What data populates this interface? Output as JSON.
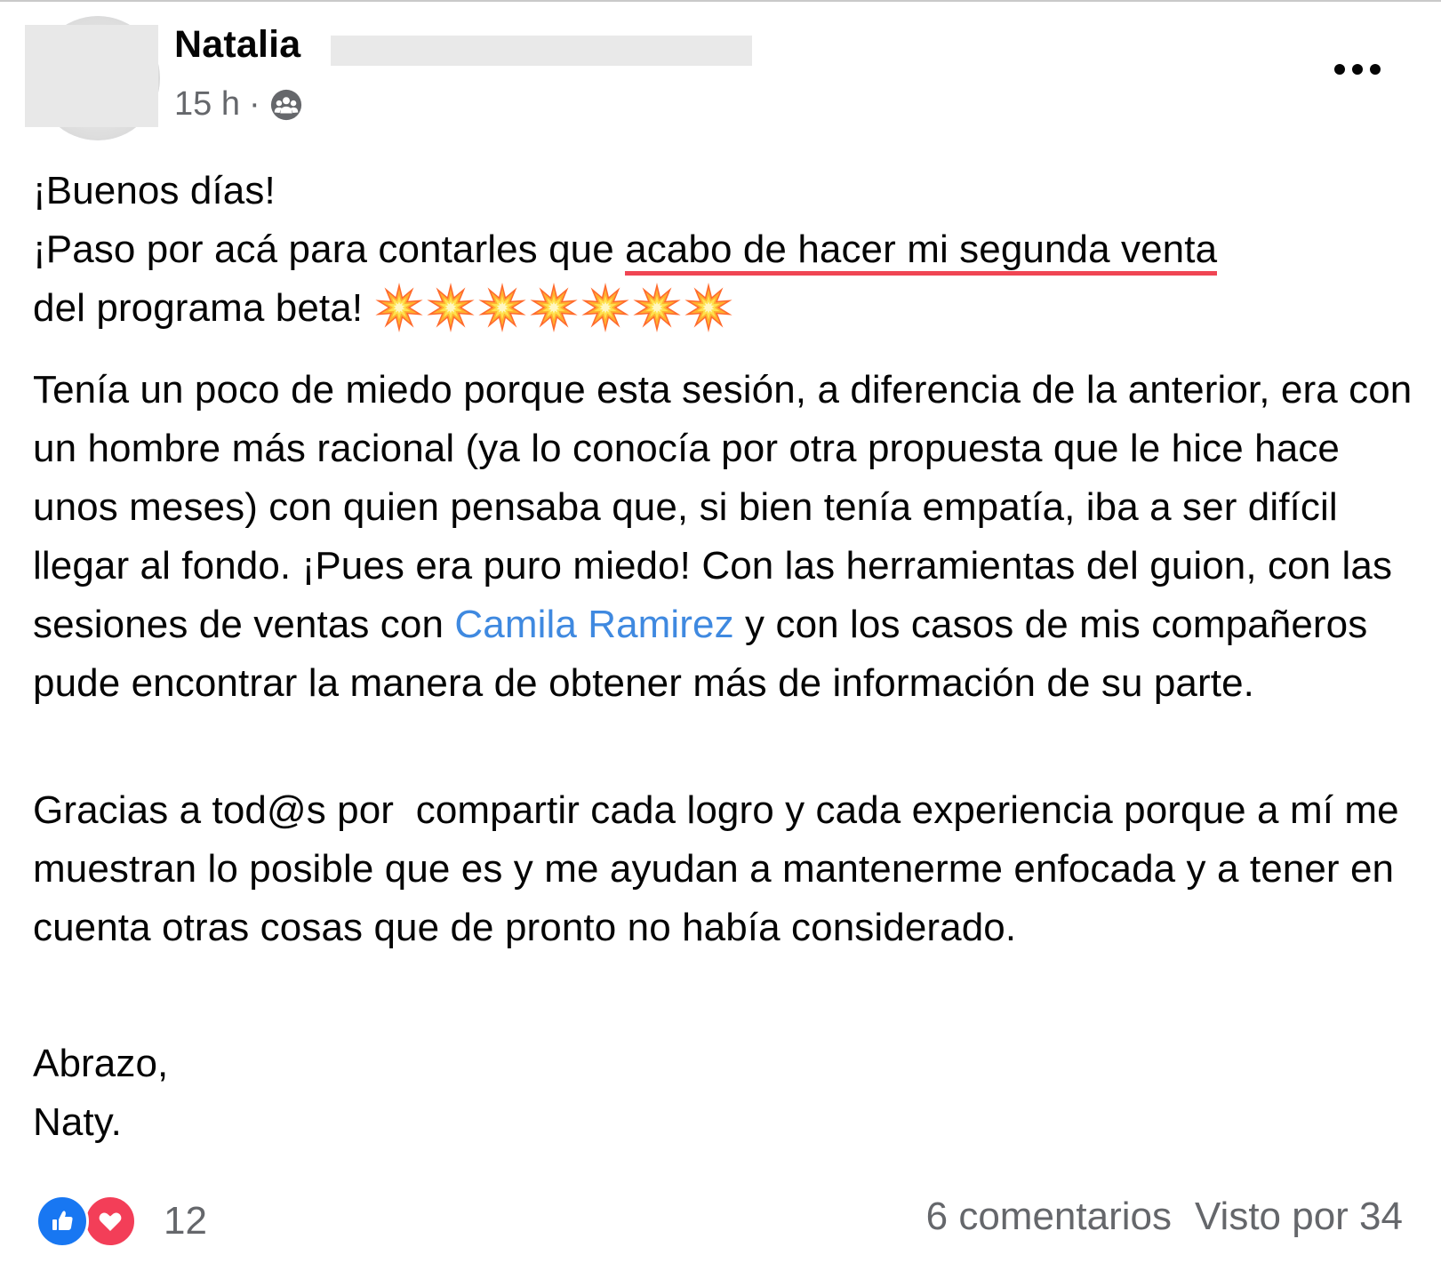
{
  "post": {
    "author_name": "Natalia",
    "timestamp": "15 h",
    "separator": "·",
    "privacy_icon": "group-icon",
    "more_icon": "more-options-icon"
  },
  "body": {
    "greeting": "¡Buenos días!",
    "line2_start": "¡Paso por acá para contarles que ",
    "line2_highlight": "acabo de hacer mi segunda venta",
    "line2_end": "del programa beta! ",
    "emoji_name": "collision-emoji",
    "emoji_count": 7,
    "para2_start": "Tenía un poco de miedo porque esta sesión, a diferencia de la anterior, era con un hombre más racional (ya lo conocía por otra propuesta que le hice hace unos meses) con quien pensaba que, si bien tenía empatía, iba a ser difícil llegar al fondo. ¡Pues era puro miedo! Con las herramientas del guion, con las sesiones de ventas con ",
    "mention": "Camila Ramirez",
    "para2_end": " y con los casos de mis compañeros pude encontrar la manera de obtener más de información de su parte.",
    "para3": "Gracias a tod@s por  compartir cada logro y cada experiencia porque a mí me muestran lo posible que es y me ayudan a mantenerme enfocada y a tener en cuenta otras cosas que de pronto no había considerado.",
    "closing": "Abrazo,",
    "signature": "Naty."
  },
  "footer": {
    "reaction_icons": [
      "like-icon",
      "love-icon"
    ],
    "reaction_count": "12",
    "comments": "6 comentarios",
    "views": "Visto por 34"
  },
  "colors": {
    "highlight_underline": "#f04553",
    "mention": "#3f89e0",
    "secondary_text": "#65676b",
    "like": "#1877f2",
    "love": "#f33e58"
  }
}
